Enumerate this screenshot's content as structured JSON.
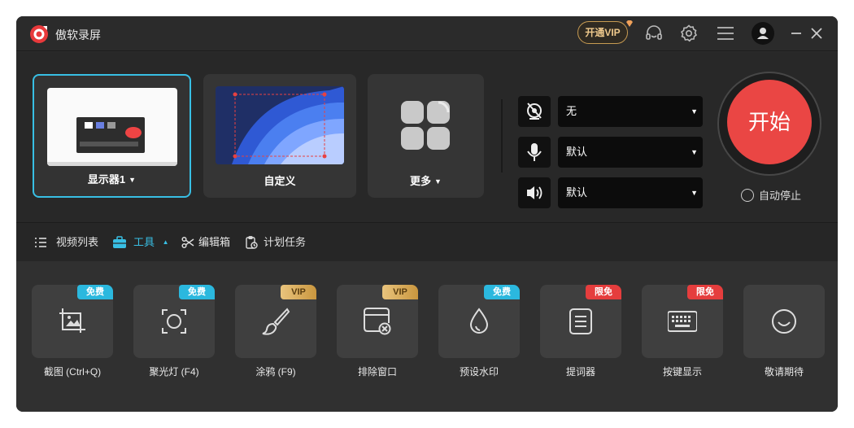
{
  "app": {
    "title": "傲软录屏",
    "vip_label": "开通VIP"
  },
  "sources": [
    {
      "label": "显示器1",
      "has_dropdown": true,
      "selected": true
    },
    {
      "label": "自定义",
      "has_dropdown": false,
      "selected": false
    },
    {
      "label": "更多",
      "has_dropdown": true,
      "selected": false
    }
  ],
  "devices": {
    "webcam": {
      "value": "无",
      "icon": "webcam-off-icon"
    },
    "microphone": {
      "value": "默认",
      "icon": "microphone-icon"
    },
    "speaker": {
      "value": "默认",
      "icon": "speaker-icon"
    }
  },
  "start": {
    "label": "开始",
    "auto_stop_label": "自动停止",
    "auto_stop_checked": false
  },
  "nav": {
    "video_list": "视频列表",
    "tools": "工具",
    "editor": "编辑箱",
    "schedule": "计划任务"
  },
  "tools": [
    {
      "label": "截图 (Ctrl+Q)",
      "badge": "免费",
      "badge_type": "free",
      "icon": "crop-icon"
    },
    {
      "label": "聚光灯 (F4)",
      "badge": "免费",
      "badge_type": "free",
      "icon": "spotlight-icon"
    },
    {
      "label": "涂鸦 (F9)",
      "badge": "VIP",
      "badge_type": "vip",
      "icon": "brush-icon"
    },
    {
      "label": "排除窗口",
      "badge": "VIP",
      "badge_type": "vip",
      "icon": "exclude-window-icon"
    },
    {
      "label": "预设水印",
      "badge": "免费",
      "badge_type": "free",
      "icon": "watermark-icon"
    },
    {
      "label": "提词器",
      "badge": "限免",
      "badge_type": "limited",
      "icon": "teleprompter-icon"
    },
    {
      "label": "按键显示",
      "badge": "限免",
      "badge_type": "limited",
      "icon": "keyboard-icon"
    },
    {
      "label": "敬请期待",
      "badge": "",
      "badge_type": "none",
      "icon": "coming-soon-icon"
    }
  ],
  "colors": {
    "accent": "#38bfe4",
    "start": "#ea4644",
    "free_badge": "#2bb8de",
    "limited_badge": "#e53d3d"
  }
}
